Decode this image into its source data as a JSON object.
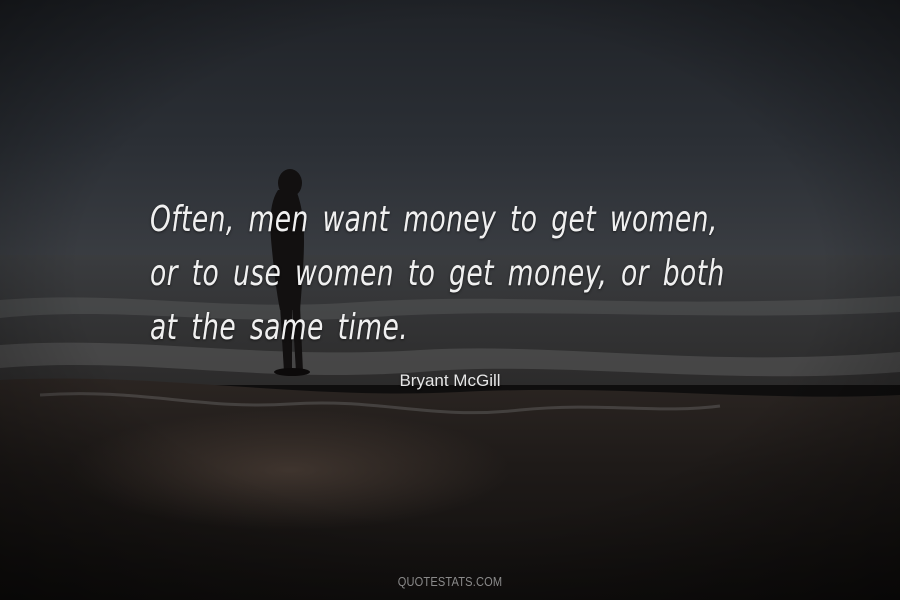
{
  "quote": {
    "lines": [
      "Often, men want money to get women,",
      "or to use women to get money, or both",
      "at the same time."
    ]
  },
  "author": "Bryant McGill",
  "watermark": "QUOTESTATS.COM",
  "colors": {
    "quote_text": "#f0f0f0",
    "author_text": "#e6e6e6",
    "watermark_text": "#8a8a8a",
    "sky": "#2a2e34",
    "sea": "#3a3d3f",
    "sand": "#1a1614"
  }
}
